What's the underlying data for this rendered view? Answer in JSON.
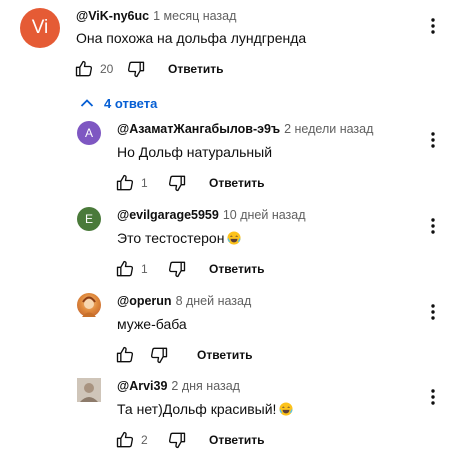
{
  "parent": {
    "avatar_text": "Vi",
    "avatar_color": "#e55b35",
    "author": "@ViK-ny6uc",
    "time": "1 месяц назад",
    "text": "Она похожа на дольфа  лундгренда",
    "likes": "20",
    "reply_label": "Ответить"
  },
  "replies_toggle": {
    "label": "4 ответа",
    "color": "#065fd4"
  },
  "replies": [
    {
      "avatar_text": "A",
      "avatar_color": "#7e57c2",
      "author": "@АзаматЖангабылов-э9ъ",
      "time": "2 недели назад",
      "text": "Но Дольф натуральный",
      "likes": "1",
      "reply_label": "Ответить"
    },
    {
      "avatar_text": "E",
      "avatar_color": "#4a7a3a",
      "author": "@evilgarage5959",
      "time": "10 дней назад",
      "text": "Это тестостерон",
      "emoji": "laughing-emoji",
      "likes": "1",
      "reply_label": "Ответить"
    },
    {
      "avatar_text": "",
      "avatar_color": "#c8702a",
      "author": "@operun",
      "time": "8 дней назад",
      "text": "муже-баба",
      "likes": "",
      "reply_label": "Ответить"
    },
    {
      "avatar_text": "",
      "avatar_color": "#b9a99a",
      "author": "@Arvi39",
      "time": "2 дня назад",
      "text": "Та нет)Дольф красивый!",
      "emoji": "laughing-emoji",
      "likes": "2",
      "reply_label": "Ответить"
    }
  ]
}
